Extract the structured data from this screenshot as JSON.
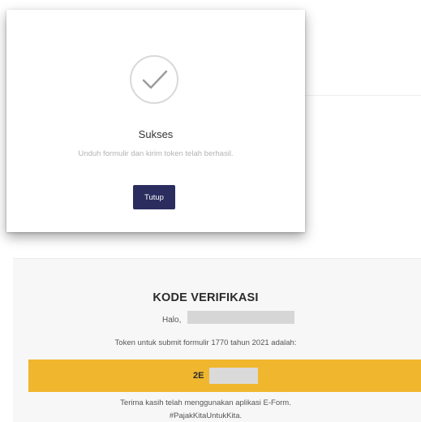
{
  "modal": {
    "title": "Sukses",
    "message": "Unduh formulir dan kirim token telah berhasil.",
    "close_label": "Tutup",
    "icon": "check-icon"
  },
  "email": {
    "heading": "KODE VERIFIKASI",
    "greeting": "Halo,",
    "token_text": "Token untuk submit formulir 1770 tahun 2021 adalah:",
    "token_visible": "2E",
    "thanks": "Terima kasih telah menggunakan aplikasi E-Form.",
    "hashtag": "#PajakKitaUntukKita."
  },
  "colors": {
    "close_button_bg": "#2a2d5e",
    "token_bar_bg": "#f0b62d",
    "check_stroke": "#9b9b9b"
  }
}
